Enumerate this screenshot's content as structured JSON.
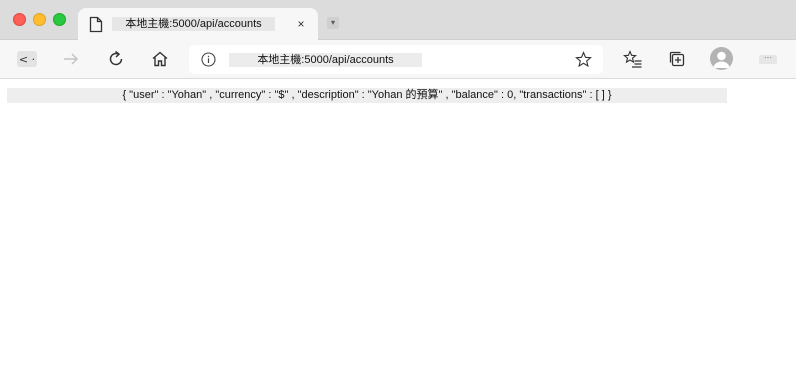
{
  "tab": {
    "title": "本地主機:5000/api/accounts",
    "close_glyph": "×",
    "new_tab_glyph": "▾"
  },
  "toolbar": {
    "back_glyph": "< ·",
    "address": "本地主機:5000/api/accounts",
    "more_glyph": "···"
  },
  "content": {
    "json_text": "{ \"user\" : \"Yohan\" , \"currency\" : \"$\" , \"description\" : \"Yohan 的預算\" , \"balance\" : 0, \"transactions\" : [ ] }"
  },
  "icons": {
    "tab": "page-icon",
    "toolbar": [
      "back-icon",
      "forward-icon",
      "refresh-icon",
      "home-icon",
      "info-icon",
      "star-icon",
      "favorites-icon",
      "collections-icon",
      "profile-avatar-icon",
      "more-icon"
    ]
  },
  "colors": {
    "close": "#fe5f57",
    "minimize": "#febc2e",
    "maximize": "#28c840",
    "tabbar": "#dcdcdc",
    "toolbar": "#f7f7f7"
  }
}
